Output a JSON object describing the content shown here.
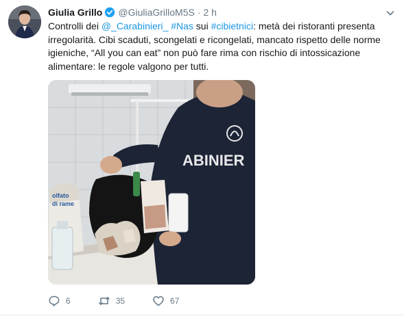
{
  "author": {
    "display_name": "Giulia Grillo",
    "handle": "@GiuliaGrilloM5S",
    "separator": "·",
    "time": "2 h",
    "verified": true
  },
  "tweet": {
    "segments": [
      {
        "text": "Controlli dei ",
        "link": false
      },
      {
        "text": "@_Carabinieri_",
        "link": true
      },
      {
        "text": " ",
        "link": false
      },
      {
        "text": "#Nas",
        "link": true
      },
      {
        "text": " sui ",
        "link": false
      },
      {
        "text": "#cibietnici",
        "link": true
      },
      {
        "text": ": metà dei ristoranti presenta irregolarità. Cibi scaduti, scongelati e ricongelati, mancato rispetto delle norme igieniche, “All you can eat” non può fare rima con rischio di intossicazione alimentare: le regole valgono per tutti.",
        "link": false
      }
    ]
  },
  "media": {
    "description_icon": "photo",
    "uniform_text": "ABINIER",
    "bag_text_1": "olfato",
    "bag_text_2": "di rame"
  },
  "actions": {
    "reply_count": "6",
    "retweet_count": "35",
    "like_count": "67"
  },
  "colors": {
    "link": "#1b95e0",
    "muted": "#657786",
    "verified": "#1da1f2"
  }
}
